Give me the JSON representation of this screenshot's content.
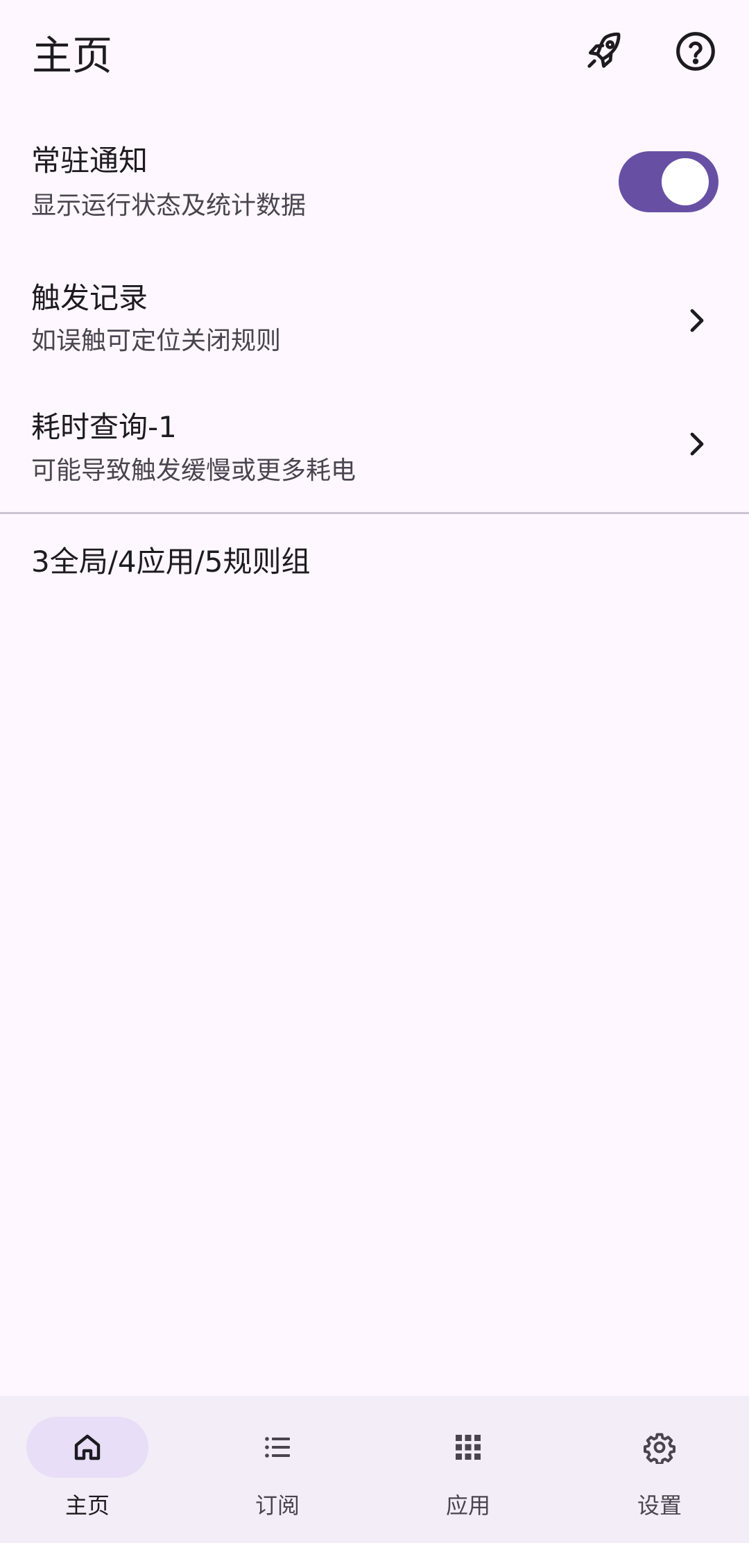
{
  "header": {
    "title": "主页",
    "actions": [
      {
        "icon": "rocket-icon"
      },
      {
        "icon": "help-icon"
      }
    ]
  },
  "settings": {
    "persistent_notification": {
      "label": "常驻通知",
      "description": "显示运行状态及统计数据",
      "enabled": true
    },
    "trigger_log": {
      "label": "触发记录",
      "description": "如误触可定位关闭规则"
    },
    "time_query": {
      "label": "耗时查询-1",
      "description": "可能导致触发缓慢或更多耗电"
    }
  },
  "summary": "3全局/4应用/5规则组",
  "bottom_nav": {
    "items": [
      {
        "label": "主页",
        "icon": "home-icon",
        "active": true
      },
      {
        "label": "订阅",
        "icon": "list-icon",
        "active": false
      },
      {
        "label": "应用",
        "icon": "apps-grid-icon",
        "active": false
      },
      {
        "label": "设置",
        "icon": "gear-icon",
        "active": false
      }
    ]
  },
  "colors": {
    "background": "#fef7ff",
    "accent": "#6750a4",
    "nav_background": "#f3edf7",
    "nav_indicator": "#e8def8"
  }
}
